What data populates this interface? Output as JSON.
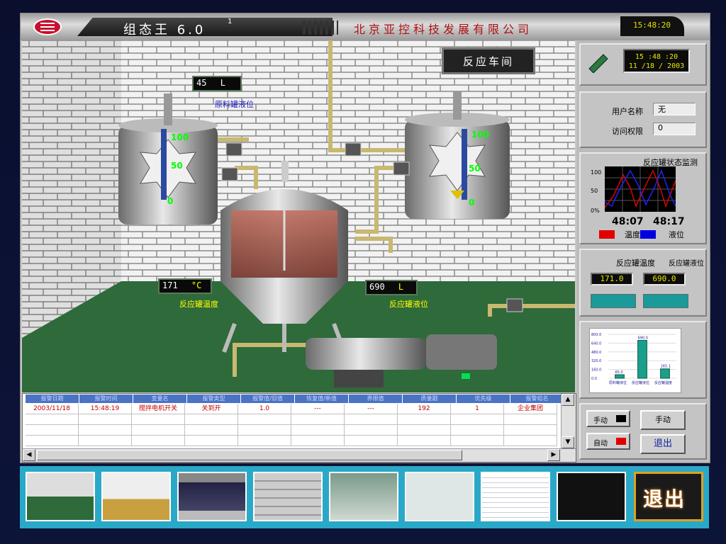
{
  "titlebar": {
    "app_name": "组态王 6.0",
    "version_sup": "1",
    "company": "北京亚控科技发展有限公司",
    "clock": "15:48:20"
  },
  "scene": {
    "workshop_title": "反应车间",
    "raw_tank_level": {
      "value": "45",
      "unit": "L",
      "label": "原料罐液位"
    },
    "reactor_temp": {
      "value": "171",
      "unit": "°C",
      "label": "反应罐温度"
    },
    "reactor_level": {
      "value": "690",
      "unit": "L",
      "label": "反应罐液位"
    },
    "left_gauge": {
      "top": "100",
      "mid": "50",
      "bottom": "0"
    },
    "right_gauge": {
      "top": "100",
      "mid": "50",
      "bottom": "0"
    }
  },
  "right_panel": {
    "clock_time": "15 :48 :20",
    "clock_date": "11 /18 / 2003",
    "user_label": "用户名称",
    "user_value": "无",
    "perm_label": "访问权限",
    "perm_value": "0",
    "monitor_title": "反应罐状态监测",
    "trend_y": [
      "100",
      "50",
      "0%"
    ],
    "trend_t1": "48:07",
    "trend_t2": "48:17",
    "legend_temp": "温度",
    "legend_level": "液位",
    "temp_label": "反应罐温度",
    "level_label": "反应罐液位",
    "temp_value": "171.0",
    "level_value": "690.0",
    "manual_small": "手动",
    "auto_small": "自动",
    "manual_btn": "手动",
    "exit_btn": "退出"
  },
  "chart_data": {
    "type": "bar",
    "categories": [
      "原料罐液位",
      "反应罐液位",
      "反应罐温度"
    ],
    "values": [
      65.0,
      690.0,
      171.0
    ],
    "value_labels": [
      "65.0",
      "690.0",
      "165.1"
    ],
    "ylim": [
      0,
      800
    ],
    "yticks": [
      "800.0",
      "640.0",
      "480.0",
      "320.0",
      "160.0",
      "0.0"
    ]
  },
  "table": {
    "headers": [
      "报警日期",
      "报警时间",
      "变量名",
      "报警类型",
      "报警值/旧值",
      "恢复值/新值",
      "界限值",
      "质量戳",
      "优先级",
      "报警组名"
    ],
    "rows": [
      [
        "2003/11/18",
        "15:48:19",
        "搅拌电机开关",
        "关到开",
        "1.0",
        "---",
        "---",
        "192",
        "1",
        "企业集团"
      ]
    ]
  },
  "thumbbar": {
    "exit_label": "退出"
  },
  "colors": {
    "accent_red": "#c8102e",
    "temp_line": "#e00000",
    "level_line": "#0000e0",
    "lcd_text": "#e8e800",
    "floor": "#2e6a3a"
  }
}
